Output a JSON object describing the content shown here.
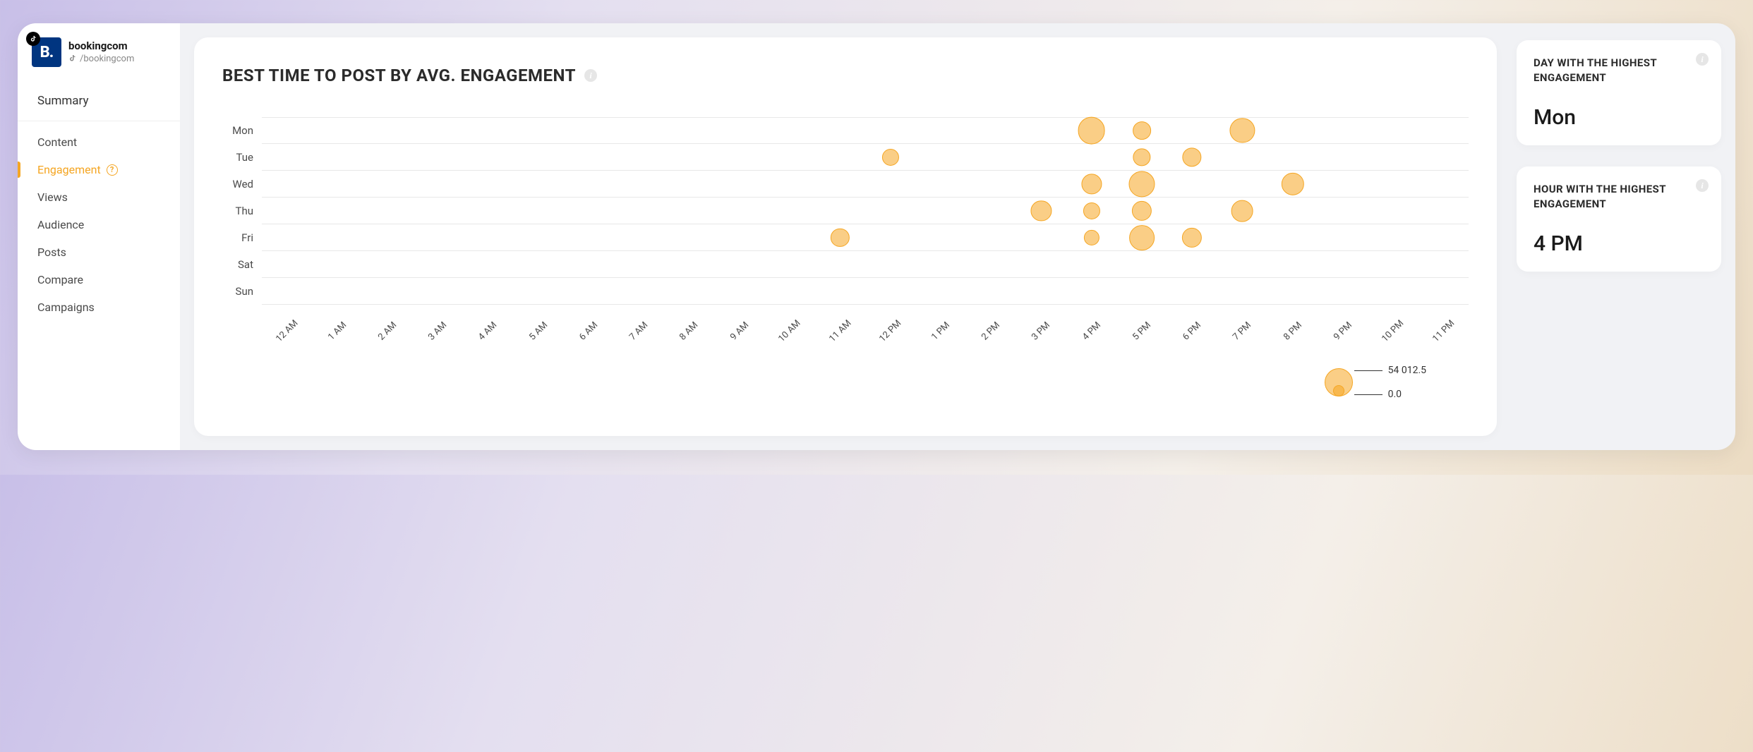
{
  "profile": {
    "avatar_initial": "B.",
    "name": "bookingcom",
    "handle": "/bookingcom"
  },
  "sidebar": {
    "items": [
      {
        "label": "Summary",
        "active": false,
        "summary": true
      },
      {
        "label": "Content",
        "active": false
      },
      {
        "label": "Engagement",
        "active": true,
        "help": true
      },
      {
        "label": "Views",
        "active": false
      },
      {
        "label": "Audience",
        "active": false
      },
      {
        "label": "Posts",
        "active": false
      },
      {
        "label": "Compare",
        "active": false
      },
      {
        "label": "Campaigns",
        "active": false
      }
    ]
  },
  "chart": {
    "title": "BEST TIME TO POST BY AVG. ENGAGEMENT",
    "legend_max": "54 012.5",
    "legend_min": "0.0"
  },
  "chart_data": {
    "type": "scatter",
    "title": "BEST TIME TO POST BY AVG. ENGAGEMENT",
    "xlabel": "",
    "ylabel": "",
    "categories_y": [
      "Mon",
      "Tue",
      "Wed",
      "Thu",
      "Fri",
      "Sat",
      "Sun"
    ],
    "categories_x": [
      "12 AM",
      "1 AM",
      "2 AM",
      "3 AM",
      "4 AM",
      "5 AM",
      "6 AM",
      "7 AM",
      "8 AM",
      "9 AM",
      "10 AM",
      "11 AM",
      "12 PM",
      "1 PM",
      "2 PM",
      "3 PM",
      "4 PM",
      "5 PM",
      "6 PM",
      "7 PM",
      "8 PM",
      "9 PM",
      "10 PM",
      "11 PM"
    ],
    "size_legend": {
      "min": 0.0,
      "max": 54012.5
    },
    "series": [
      {
        "name": "Avg. engagement",
        "points": [
          {
            "day": "Mon",
            "hour": "4 PM",
            "value": 50000
          },
          {
            "day": "Mon",
            "hour": "5 PM",
            "value": 15000
          },
          {
            "day": "Mon",
            "hour": "7 PM",
            "value": 38000
          },
          {
            "day": "Tue",
            "hour": "12 PM",
            "value": 12000
          },
          {
            "day": "Tue",
            "hour": "5 PM",
            "value": 14000
          },
          {
            "day": "Tue",
            "hour": "6 PM",
            "value": 18000
          },
          {
            "day": "Wed",
            "hour": "4 PM",
            "value": 22000
          },
          {
            "day": "Wed",
            "hour": "5 PM",
            "value": 44000
          },
          {
            "day": "Wed",
            "hour": "8 PM",
            "value": 30000
          },
          {
            "day": "Thu",
            "hour": "3 PM",
            "value": 22000
          },
          {
            "day": "Thu",
            "hour": "4 PM",
            "value": 12000
          },
          {
            "day": "Thu",
            "hour": "5 PM",
            "value": 20000
          },
          {
            "day": "Thu",
            "hour": "7 PM",
            "value": 26000
          },
          {
            "day": "Fri",
            "hour": "11 AM",
            "value": 16000
          },
          {
            "day": "Fri",
            "hour": "4 PM",
            "value": 9000
          },
          {
            "day": "Fri",
            "hour": "5 PM",
            "value": 40000
          },
          {
            "day": "Fri",
            "hour": "6 PM",
            "value": 20000
          }
        ]
      }
    ]
  },
  "stats": {
    "day": {
      "label": "DAY WITH THE HIGHEST ENGAGEMENT",
      "value": "Mon"
    },
    "hour": {
      "label": "HOUR WITH THE HIGHEST ENGAGEMENT",
      "value": "4 PM"
    }
  }
}
